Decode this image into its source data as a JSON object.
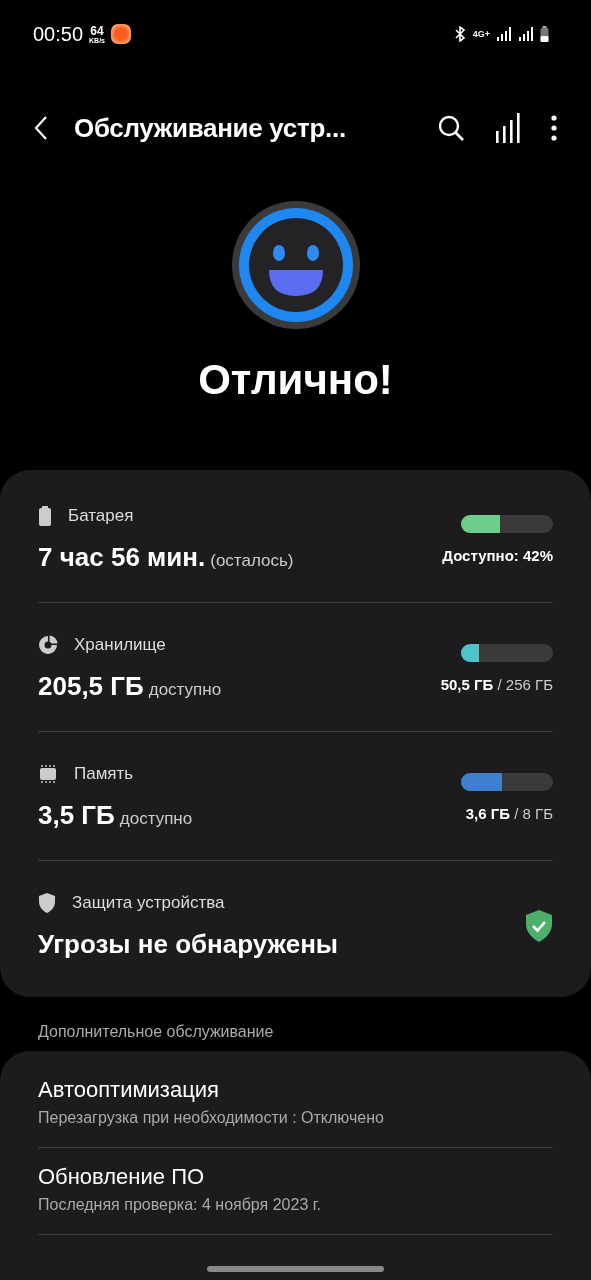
{
  "status_bar": {
    "time": "00:50",
    "speed_value": "64",
    "speed_unit": "KB/s",
    "network": "4G+"
  },
  "toolbar": {
    "title": "Обслуживание устр..."
  },
  "status": {
    "label": "Отлично!"
  },
  "metrics": [
    {
      "kind": "battery",
      "label": "Батарея",
      "value": "7 час 56 мин.",
      "suffix": "(осталось)",
      "level": 0.42,
      "color": "#6cce8a",
      "reading": "Доступно: 42%"
    },
    {
      "kind": "storage",
      "label": "Хранилище",
      "value": "205,5 ГБ",
      "suffix": "доступно",
      "level": 0.2,
      "color": "#4fc3c9",
      "reading": "**50,5 ГБ** / 256 ГБ"
    },
    {
      "kind": "memory",
      "label": "Память",
      "value": "3,5 ГБ",
      "suffix": "доступно",
      "level": 0.45,
      "color": "#3f7fd0",
      "reading": "**3,6 ГБ** / 8 ГБ"
    },
    {
      "kind": "security",
      "label": "Защита устройства",
      "value": "Угрозы не обнаружены"
    }
  ],
  "additional": {
    "header": "Дополнительное обслуживание",
    "items": [
      {
        "title": "Автооптимизация",
        "subtitle": "Перезагрузка при необходимости : Отключено"
      },
      {
        "title": "Обновление ПО",
        "subtitle": "Последняя проверка: 4 ноября 2023 г."
      }
    ]
  }
}
